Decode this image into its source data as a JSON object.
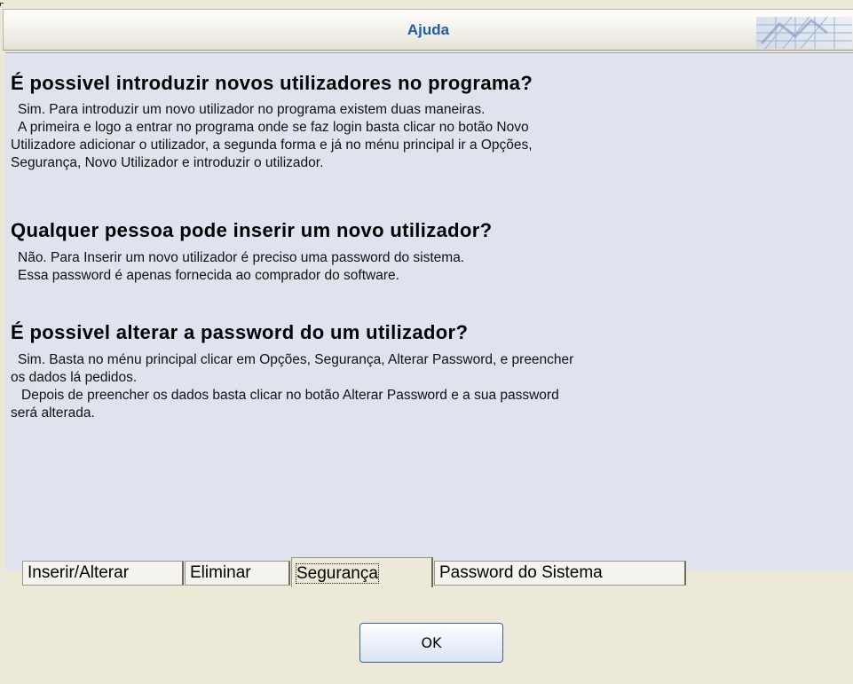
{
  "window": {
    "title": "Ajuda"
  },
  "faq": [
    {
      "question": "É possivel introduzir novos utilizadores no programa?",
      "answer_lines": [
        "Sim. Para introduzir um novo utilizador no programa existem duas maneiras.",
        "A primeira e logo a entrar no programa onde se faz login basta clicar no botão Novo",
        "Utilizadore adicionar o utilizador, a segunda forma e já no ménu principal ir a Opções,",
        "Segurança, Novo Utilizador e introduzir o utilizador."
      ]
    },
    {
      "question": "Qualquer pessoa pode inserir um novo utilizador?",
      "answer_lines": [
        "Não. Para Inserir um novo utilizador é preciso uma password do sistema.",
        "Essa password é apenas fornecida ao comprador do software."
      ]
    },
    {
      "question": "É possivel alterar a password do um utilizador?",
      "answer_lines": [
        "Sim. Basta no ménu principal clicar em Opções, Segurança, Alterar Password, e preencher",
        "os dados lá pedidos.",
        "Depois de preencher os dados basta clicar no botão Alterar Password e a sua password",
        "será alterada."
      ]
    }
  ],
  "tabs": [
    {
      "label": "Inserir/Alterar",
      "active": false
    },
    {
      "label": "Eliminar",
      "active": false
    },
    {
      "label": "Segurança",
      "active": true
    },
    {
      "label": "Password do Sistema",
      "active": false
    }
  ],
  "buttons": {
    "ok_label": "OK"
  },
  "colors": {
    "title": "#1f5ca8",
    "content_bg": "#dfe3ee",
    "window_bg": "#ECE9D8"
  }
}
